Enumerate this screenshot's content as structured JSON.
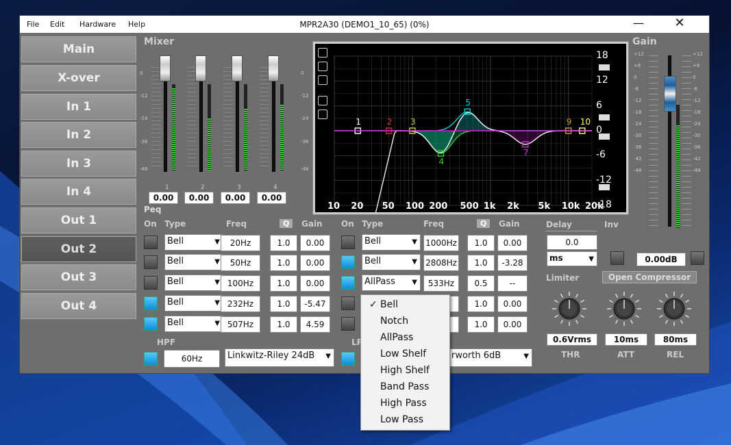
{
  "window": {
    "title": "MPR2A30 (DEMO1_10_65) (0%)",
    "minimize": "—",
    "close": "✕"
  },
  "menu": [
    "File",
    "Edit",
    "Hardware",
    "Help"
  ],
  "nav": [
    "Main",
    "X-over",
    "In 1",
    "In 2",
    "In 3",
    "In 4",
    "Out 1",
    "Out 2",
    "Out 3",
    "Out 4"
  ],
  "nav_active": "Out 2",
  "mixer": {
    "label": "Mixer",
    "scale": [
      "0",
      "-12",
      "-24",
      "-36",
      "-48"
    ],
    "channels": [
      "1",
      "2",
      "3",
      "4"
    ],
    "values": [
      "0.00",
      "0.00",
      "0.00",
      "0.00"
    ]
  },
  "gain": {
    "label": "Gain",
    "scale": [
      "+12",
      "+6",
      "0",
      "-6",
      "-12",
      "-18",
      "-24",
      "-30",
      "-36",
      "-42",
      "-48"
    ]
  },
  "graph": {
    "y_labels": [
      "18",
      "12",
      "6",
      "0",
      "-6",
      "-12",
      "-18"
    ],
    "x_labels": [
      "10",
      "20",
      "50",
      "100",
      "200",
      "500",
      "1k",
      "2k",
      "5k",
      "10k",
      "20k"
    ],
    "band_markers": [
      "1",
      "2",
      "3",
      "4",
      "5",
      "7",
      "9",
      "10"
    ]
  },
  "peq": {
    "label": "Peq",
    "headers": [
      "On",
      "Type",
      "Freq",
      "Q",
      "Gain"
    ],
    "left": [
      {
        "type": "Bell",
        "freq": "20Hz",
        "q": "1.0",
        "gain": "0.00",
        "on": false
      },
      {
        "type": "Bell",
        "freq": "50Hz",
        "q": "1.0",
        "gain": "0.00",
        "on": false
      },
      {
        "type": "Bell",
        "freq": "100Hz",
        "q": "1.0",
        "gain": "0.00",
        "on": false
      },
      {
        "type": "Bell",
        "freq": "232Hz",
        "q": "1.0",
        "gain": "-5.47",
        "on": true
      },
      {
        "type": "Bell",
        "freq": "507Hz",
        "q": "1.0",
        "gain": "4.59",
        "on": true
      }
    ],
    "right": [
      {
        "type": "Bell",
        "freq": "1000Hz",
        "q": "1.0",
        "gain": "0.00",
        "on": false
      },
      {
        "type": "Bell",
        "freq": "2808Hz",
        "q": "1.0",
        "gain": "-3.28",
        "on": true
      },
      {
        "type": "AllPass",
        "freq": "533Hz",
        "q": "0.5",
        "gain": "--",
        "on": true
      },
      {
        "type": "",
        "freq": "Hz",
        "q": "1.0",
        "gain": "0.00",
        "on": false
      },
      {
        "type": "",
        "freq": "Hz",
        "q": "1.0",
        "gain": "0.00",
        "on": false
      }
    ]
  },
  "hpf": {
    "label": "HPF",
    "freq": "60Hz",
    "type": "Linkwitz-Riley 24dB"
  },
  "lpf": {
    "label": "LP",
    "type": "rworth 6dB"
  },
  "delay": {
    "label": "Delay",
    "value": "0.0",
    "unit": "ms"
  },
  "inv": {
    "label": "Inv",
    "gain_value": "0.00dB"
  },
  "limiter": {
    "label": "Limiter",
    "compressor_button": "Open Compressor",
    "thr": "0.6Vrms",
    "att": "10ms",
    "rel": "80ms",
    "thr_label": "THR",
    "att_label": "ATT",
    "rel_label": "REL"
  },
  "dropdown": {
    "items": [
      "Bell",
      "Notch",
      "AllPass",
      "Low Shelf",
      "High Shelf",
      "Band Pass",
      "High Pass",
      "Low Pass"
    ],
    "selected": "Bell",
    "check": "✓"
  },
  "colors": {
    "accent": "#1ea7ff",
    "meter": "#33cc33"
  }
}
